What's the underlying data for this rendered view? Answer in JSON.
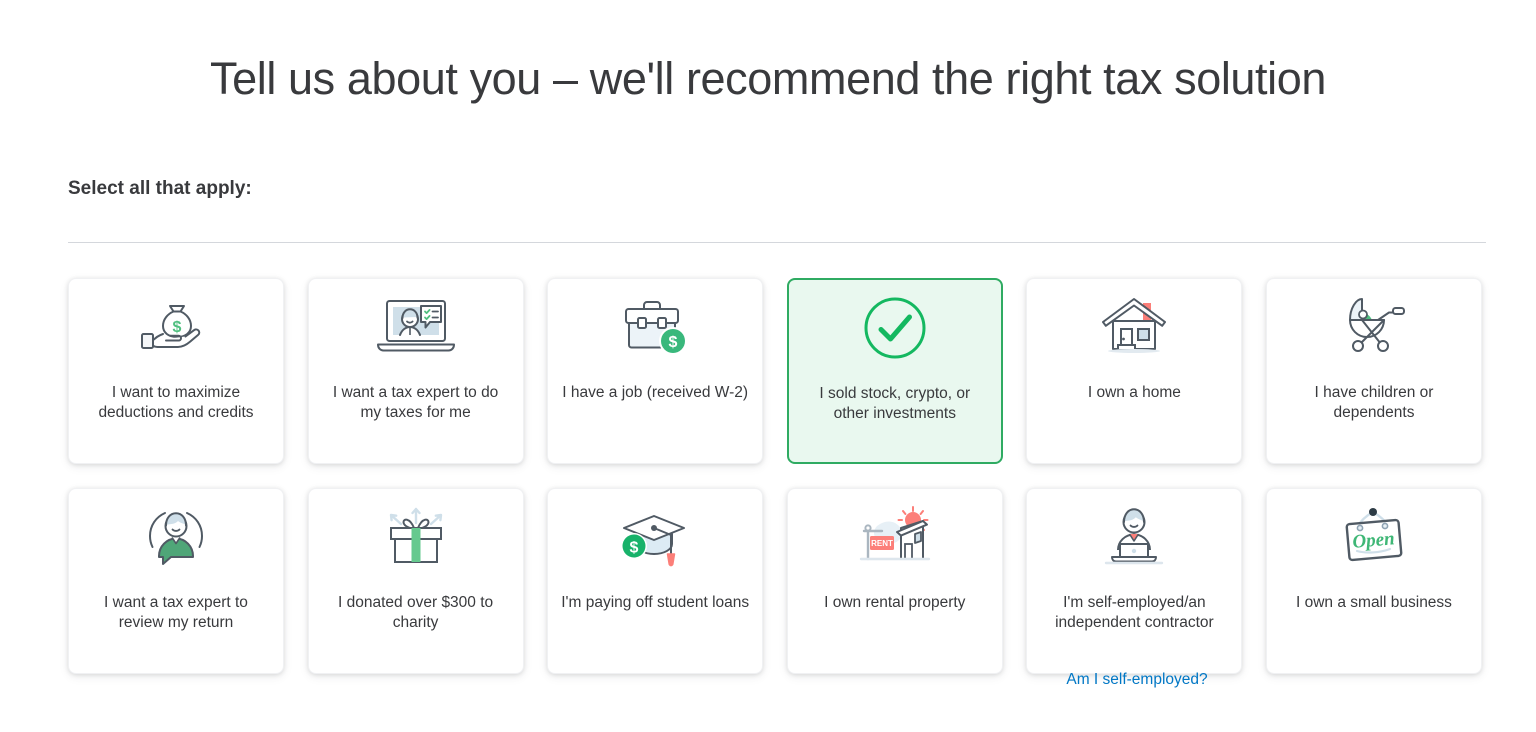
{
  "header": {
    "title": "Tell us about you – we'll recommend the right tax solution",
    "subhead": "Select all that apply:"
  },
  "colors": {
    "selected_border": "#2fab62",
    "selected_fill": "#e9f8ef",
    "accent_green": "#14b860",
    "link_blue": "#0077c5",
    "text": "#393a3d",
    "icon_stroke": "#505a64",
    "icon_blue_fill": "#cfdfe9",
    "icon_red": "#fc7f79",
    "card_bg": "#ffffff",
    "divider": "#d4d7dc"
  },
  "options": [
    {
      "id": "maximize-deductions",
      "label": "I want to maximize deductions and credits",
      "icon": "money-bag-in-hand-icon",
      "selected": false
    },
    {
      "id": "tax-expert-do-taxes",
      "label": "I want a tax expert to do my taxes for me",
      "icon": "laptop-expert-icon",
      "selected": false
    },
    {
      "id": "have-a-job-w2",
      "label": "I have a job (received W-2)",
      "icon": "briefcase-dollar-icon",
      "selected": false
    },
    {
      "id": "sold-investments",
      "label": "I sold stock, crypto, or other investments",
      "icon": "check-circle-icon",
      "selected": true
    },
    {
      "id": "own-a-home",
      "label": "I own a home",
      "icon": "house-icon",
      "selected": false
    },
    {
      "id": "children-dependents",
      "label": "I have children or dependents",
      "icon": "stroller-icon",
      "selected": false
    },
    {
      "id": "expert-review-return",
      "label": "I want a tax expert to review my return",
      "icon": "person-chat-bubble-icon",
      "selected": false
    },
    {
      "id": "donated-charity",
      "label": "I donated over $300 to charity",
      "icon": "gift-box-icon",
      "selected": false
    },
    {
      "id": "student-loans",
      "label": "I'm paying off student loans",
      "icon": "graduation-cap-dollar-icon",
      "selected": false
    },
    {
      "id": "rental-property",
      "label": "I own rental property",
      "icon": "rent-house-sign-icon",
      "selected": false
    },
    {
      "id": "self-employed",
      "label": "I'm self-employed/an independent contractor",
      "icon": "person-laptop-icon",
      "selected": false
    },
    {
      "id": "small-business",
      "label": "I own a small business",
      "icon": "open-sign-icon",
      "selected": false
    }
  ],
  "helper_link": {
    "label": "Am I self-employed?"
  }
}
